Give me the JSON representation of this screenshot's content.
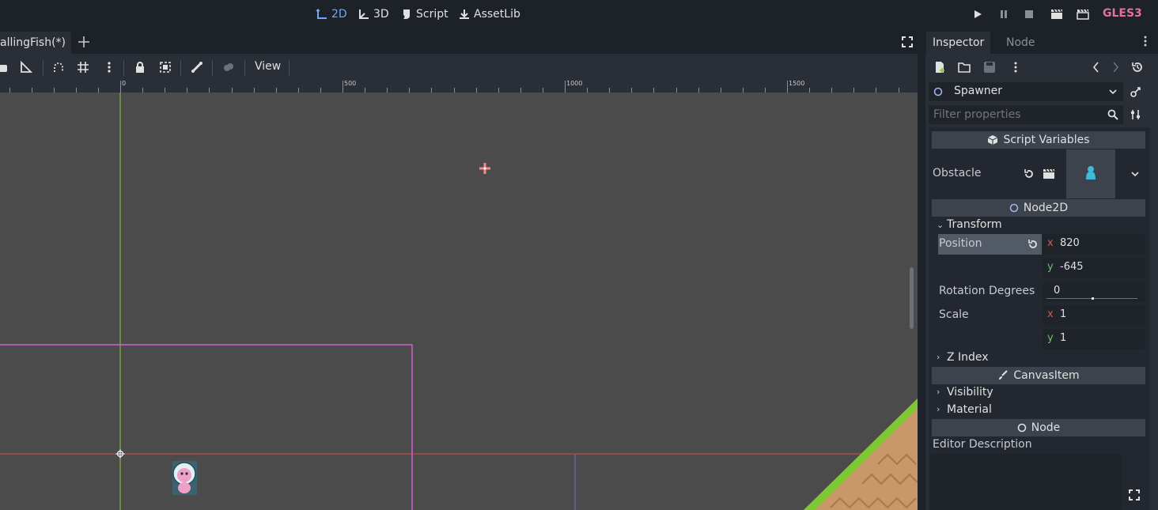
{
  "topbar": {
    "modes": [
      {
        "label": "2D",
        "active": true
      },
      {
        "label": "3D",
        "active": false
      },
      {
        "label": "Script",
        "active": false
      },
      {
        "label": "AssetLib",
        "active": false
      }
    ],
    "renderer": "GLES3"
  },
  "scene_tab": {
    "label": "allingFish(*)"
  },
  "toolbar": {
    "view_label": "View"
  },
  "ruler": {
    "labels": [
      "0",
      "500",
      "1000",
      "1500"
    ]
  },
  "inspector": {
    "tabs": [
      {
        "label": "Inspector",
        "active": true
      },
      {
        "label": "Node",
        "active": false
      }
    ],
    "node_name": "Spawner",
    "filter_placeholder": "Filter properties",
    "sections": {
      "script_variables": "Script Variables",
      "node2d": "Node2D",
      "canvas_item": "CanvasItem",
      "node": "Node"
    },
    "obstacle_label": "Obstacle",
    "transform_label": "Transform",
    "position_label": "Position",
    "position_x": "820",
    "position_y": "-645",
    "rotation_label": "Rotation Degrees",
    "rotation_value": "0",
    "scale_label": "Scale",
    "scale_x": "1",
    "scale_y": "1",
    "z_index_label": "Z Index",
    "visibility_label": "Visibility",
    "material_label": "Material",
    "editor_description_label": "Editor Description",
    "axis_x": "x",
    "axis_y": "y"
  },
  "colors": {
    "accent": "#6fa8ff",
    "renderer": "#e66fa0",
    "viewport_bg": "#4b4b4b",
    "camera_rect": "#d35fd3",
    "x_axis": "#d84848",
    "y_axis": "#8fc93a",
    "grass": "#7ec832",
    "dirt": "#c89868"
  }
}
